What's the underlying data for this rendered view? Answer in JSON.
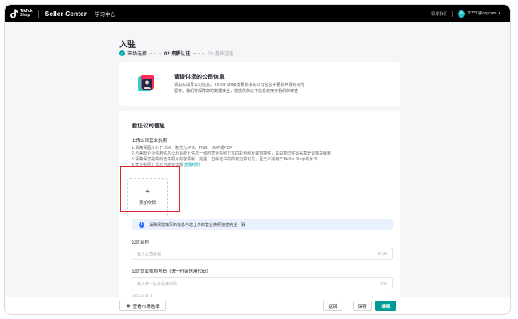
{
  "header": {
    "logo_text_line1": "TikTok",
    "logo_text_line2": "Shop",
    "app_title": "Seller Center",
    "learn_link": "学习中心",
    "contact_label": "联系我们",
    "avatar_initial": "h",
    "account_email": "2***7@qq.com"
  },
  "page": {
    "title": "入驻",
    "steps": [
      {
        "label": "市场选择",
        "state": "done"
      },
      {
        "label": "02 资质认证",
        "state": "active"
      },
      {
        "label": "03 基础信息",
        "state": "pending"
      }
    ]
  },
  "info_card": {
    "title": "请提供您的公司信息",
    "desc_line1": "请如实填写公司信息。TikTok Shop按要求核实公司信息并要求申请的权利",
    "desc_line2": "留存。我们将保障您的数据安全，您提供的以下信息仅用于我们的审查"
  },
  "verify": {
    "section_title": "验证公司信息",
    "upload_label": "上传公司营业执照",
    "rules": [
      "1.请确保图片小于10M，格式为JPG、PNG、BMP或PDF",
      "2.与美国企业信用信息公示系统上信息一致的营业执照正本的彩色照片或扫描件，黑白复印件需盖章登记机关解释",
      "3.请确保您提供的证件照片内容清晰、完整，边缘证书的所有边界可见，且无不适用于TikTok Shop的水印",
      "4.营业执照上显示当前有效期"
    ],
    "rules_link": "查看样例",
    "upload_button": "添加文件",
    "upload_plus": "+",
    "notice_icon": "i",
    "notice_text": "请确保您填写的信息与您上传的营业执照信息完全一致",
    "company_name_label": "公司名称",
    "company_name_placeholder": "输入公司名称",
    "company_name_count": "0/120",
    "license_label": "公司营业执照号码（统一社会信用代码）",
    "license_placeholder": "输入统一社会信用代码",
    "license_count": "0/18",
    "more_label": "法定代表人"
  },
  "footer": {
    "view_market_label": "查看市场选择",
    "back_label": "返回",
    "save_label": "保存",
    "next_label": "继续"
  },
  "colors": {
    "brand_teal": "#009995",
    "highlight_red": "#e0242b",
    "notice_bg": "#e8f1fd"
  },
  "icons": {
    "logo": "tiktok-logo-icon",
    "step_done": "check-icon",
    "notice": "info-icon",
    "view": "eye-icon"
  }
}
